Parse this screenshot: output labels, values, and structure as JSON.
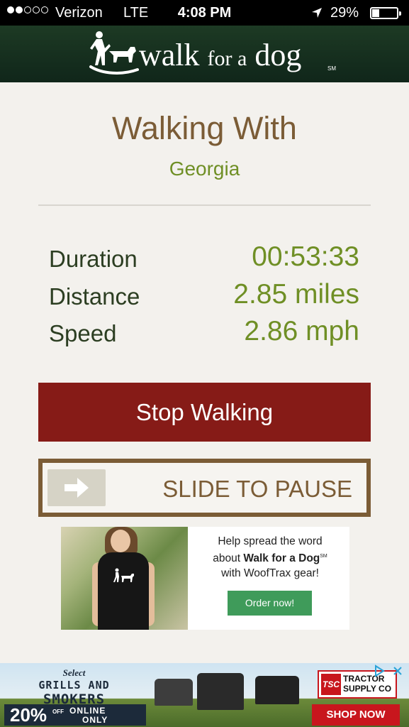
{
  "status_bar": {
    "carrier": "Verizon",
    "network": "LTE",
    "time": "4:08 PM",
    "battery_percent_text": "29%",
    "battery_level": 0.29,
    "signal_bars": 2,
    "signal_total": 5
  },
  "header": {
    "brand_part1": "walk",
    "brand_part2": "for a",
    "brand_part3": "dog",
    "service_mark": "SM"
  },
  "walk": {
    "title": "Walking With",
    "dog_name": "Georgia"
  },
  "stats": [
    {
      "label": "Duration",
      "value": "00:53:33"
    },
    {
      "label": "Distance",
      "value": "2.85 miles"
    },
    {
      "label": "Speed",
      "value": "2.86 mph"
    }
  ],
  "actions": {
    "stop_label": "Stop Walking",
    "slide_label": "SLIDE TO PAUSE"
  },
  "promo": {
    "line1": "Help spread the word",
    "line2_prefix": "about ",
    "line2_bold": "Walk for a Dog",
    "line2_mark": "SM",
    "line3": "with WoofTrax gear!",
    "button_label": "Order now!"
  },
  "banner_ad": {
    "select": "Select",
    "line1": "GRILLS AND",
    "line2": "SMOKERS",
    "percent": "20%",
    "off": "OFF",
    "online": "ONLINE",
    "only": "ONLY",
    "brand_badge": "TSC",
    "brand_line1": "TRACTOR",
    "brand_line2": "SUPPLY CO",
    "cta": "SHOP NOW"
  },
  "colors": {
    "header_green": "#1d3a24",
    "title_brown": "#7b5c36",
    "value_green": "#6f8f25",
    "stop_red": "#861b17",
    "order_green": "#3f9b5a"
  }
}
